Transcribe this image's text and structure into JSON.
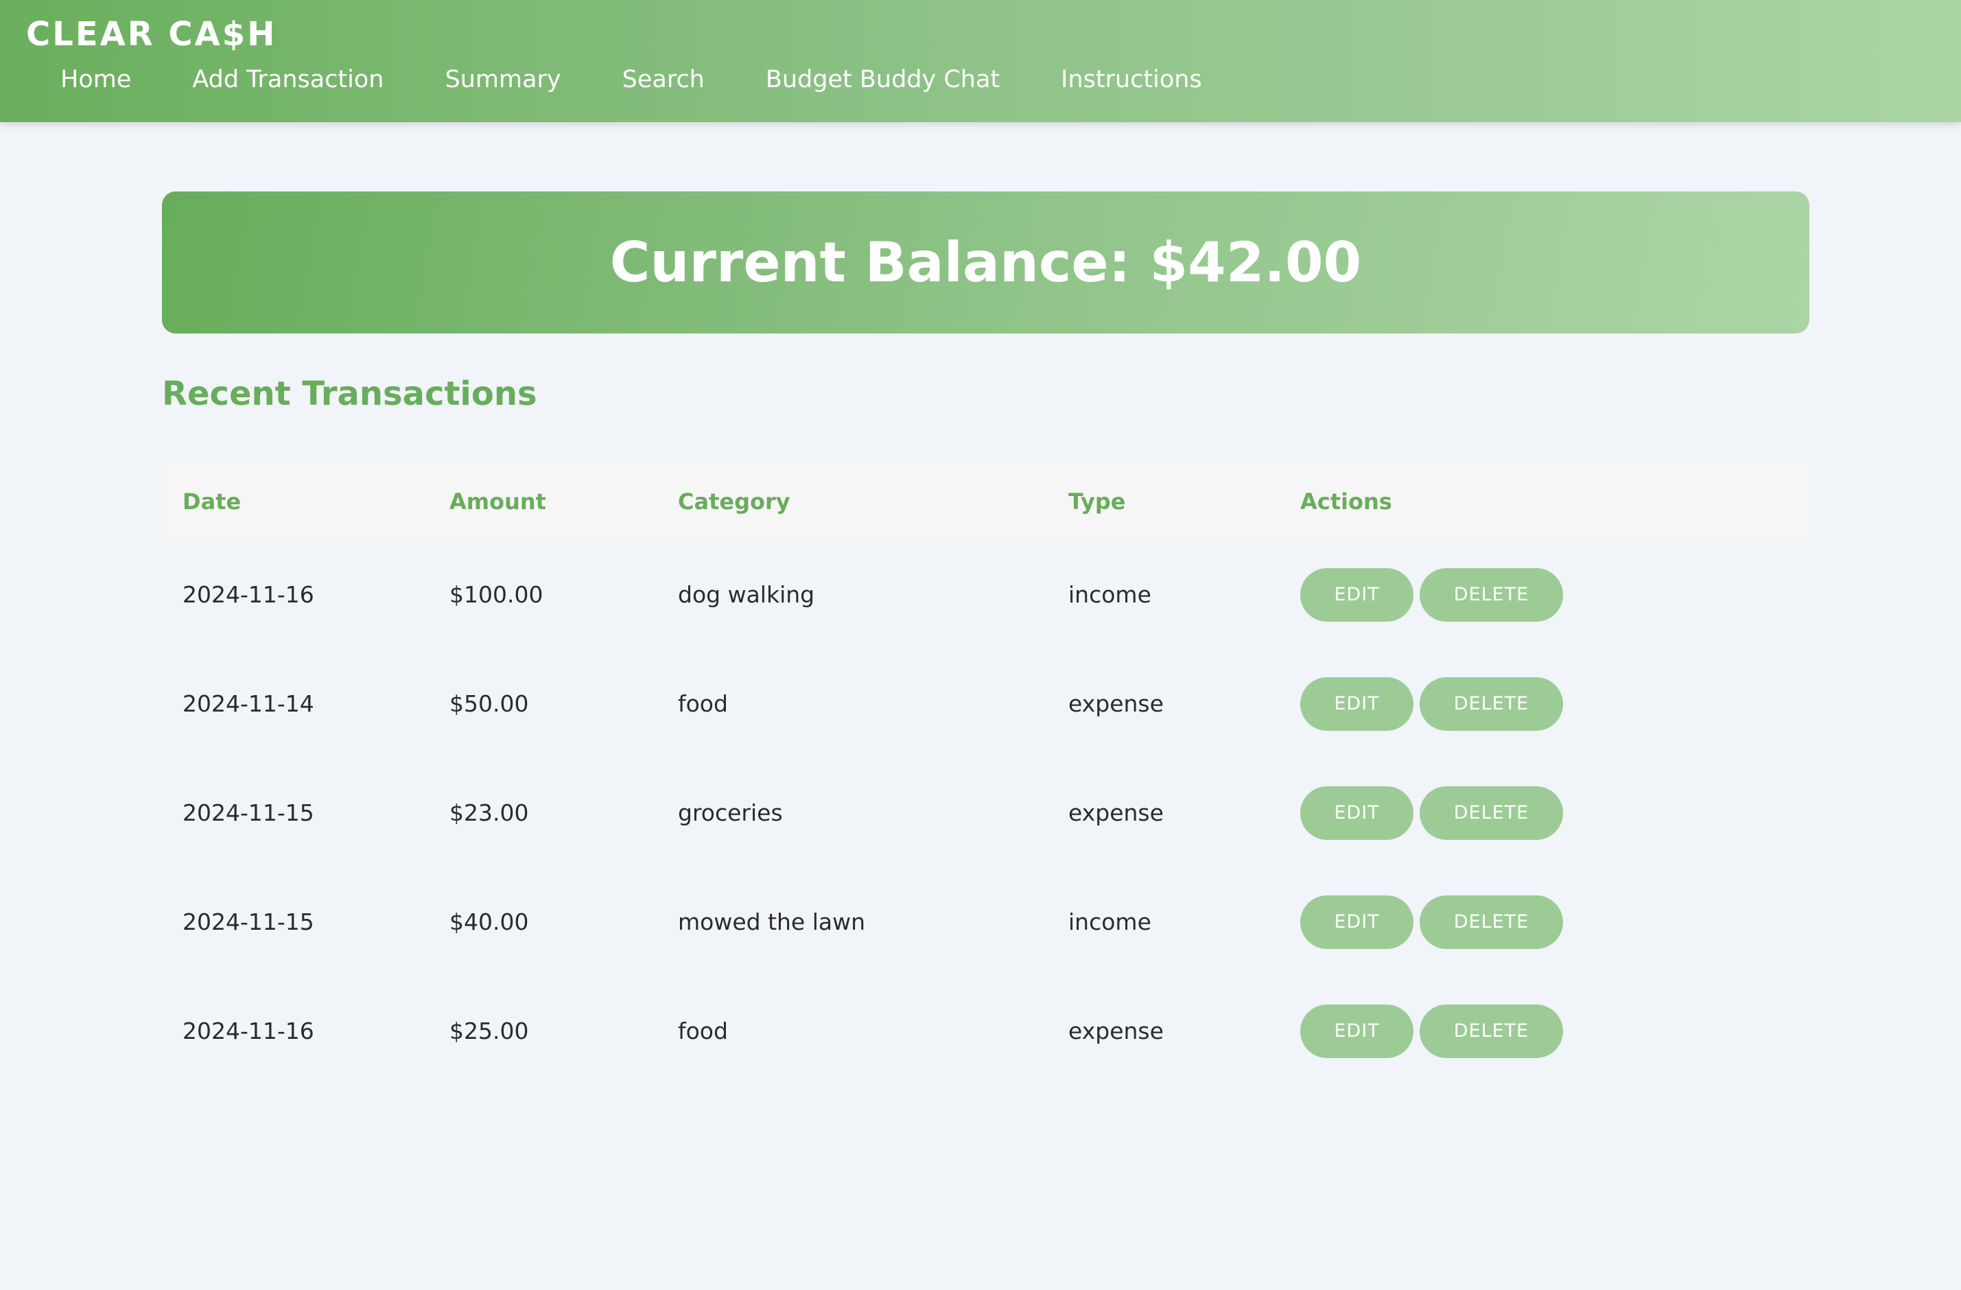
{
  "brand": "CLEAR CA$H",
  "nav": [
    "Home",
    "Add Transaction",
    "Summary",
    "Search",
    "Budget Buddy Chat",
    "Instructions"
  ],
  "balance": "Current Balance: $42.00",
  "section_title": "Recent Transactions",
  "table": {
    "headers": [
      "Date",
      "Amount",
      "Category",
      "Type",
      "Actions"
    ],
    "rows": [
      {
        "date": "2024-11-16",
        "amount": "$100.00",
        "category": "dog walking",
        "type": "income"
      },
      {
        "date": "2024-11-14",
        "amount": "$50.00",
        "category": "food",
        "type": "expense"
      },
      {
        "date": "2024-11-15",
        "amount": "$23.00",
        "category": "groceries",
        "type": "expense"
      },
      {
        "date": "2024-11-15",
        "amount": "$40.00",
        "category": "mowed the lawn",
        "type": "income"
      },
      {
        "date": "2024-11-16",
        "amount": "$25.00",
        "category": "food",
        "type": "expense"
      }
    ],
    "edit_label": "EDIT",
    "delete_label": "DELETE"
  }
}
